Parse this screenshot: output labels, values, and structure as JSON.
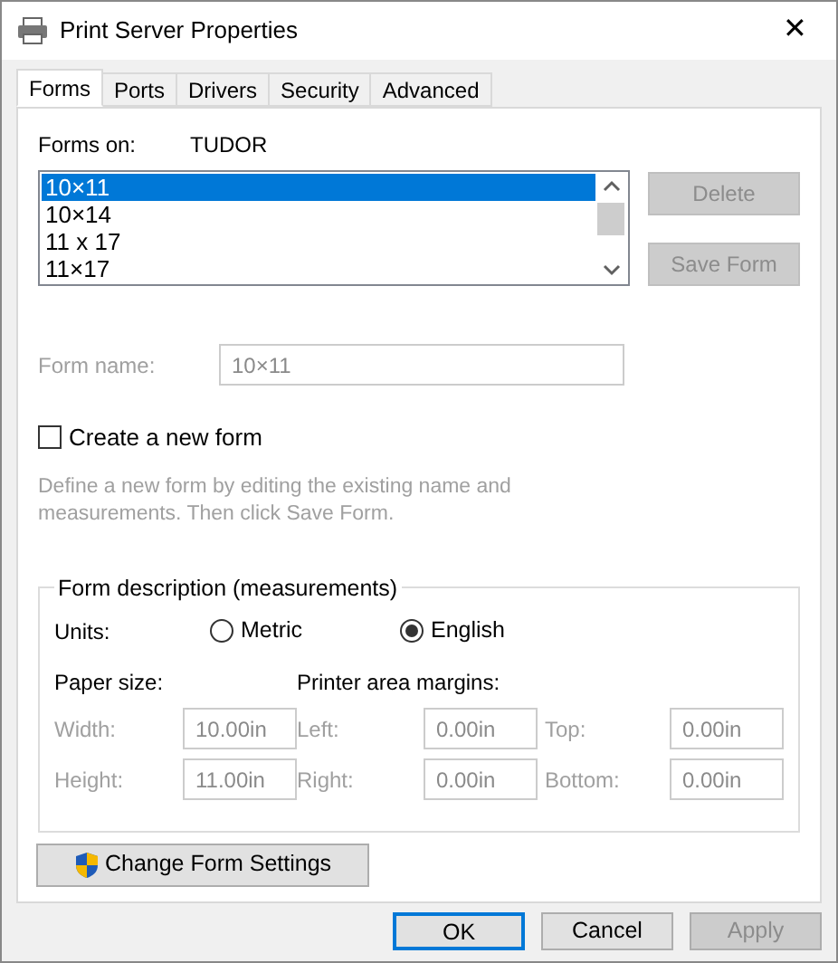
{
  "window": {
    "title": "Print Server Properties",
    "close": "✕"
  },
  "tabs": [
    {
      "label": "Forms",
      "selected": true
    },
    {
      "label": "Ports",
      "selected": false
    },
    {
      "label": "Drivers",
      "selected": false
    },
    {
      "label": "Security",
      "selected": false
    },
    {
      "label": "Advanced",
      "selected": false
    }
  ],
  "forms_on": {
    "label": "Forms on:",
    "value": "TUDOR"
  },
  "forms_list": [
    {
      "label": "10×11",
      "selected": true
    },
    {
      "label": "10×14",
      "selected": false
    },
    {
      "label": "11 x 17",
      "selected": false
    },
    {
      "label": "11×17",
      "selected": false
    }
  ],
  "list_buttons": [
    {
      "label": "Delete",
      "disabled": true
    },
    {
      "label": "Save Form",
      "disabled": true
    }
  ],
  "form_name": {
    "label": "Form name:",
    "value": "10×11",
    "disabled": true
  },
  "create_new_form": {
    "label": "Create a new form",
    "checked": false
  },
  "hint": "Define a new form by editing the existing name and measurements. Then click Save Form.",
  "form_description": {
    "title": "Form description (measurements)",
    "units": {
      "label": "Units:",
      "options": [
        {
          "label": "Metric",
          "selected": false
        },
        {
          "label": "English",
          "selected": true
        }
      ]
    },
    "paper_size": {
      "label": "Paper size:",
      "fields": [
        {
          "label": "Width:",
          "value": "10.00in",
          "disabled": true
        },
        {
          "label": "Height:",
          "value": "11.00in",
          "disabled": true
        }
      ]
    },
    "margins": {
      "label": "Printer area margins:",
      "fields": [
        {
          "label": "Left:",
          "value": "0.00in",
          "disabled": true
        },
        {
          "label": "Top:",
          "value": "0.00in",
          "disabled": true
        },
        {
          "label": "Right:",
          "value": "0.00in",
          "disabled": true
        },
        {
          "label": "Bottom:",
          "value": "0.00in",
          "disabled": true
        }
      ]
    }
  },
  "change_settings_button": {
    "label": "Change Form Settings"
  },
  "dialog_buttons": [
    {
      "label": "OK",
      "default": true,
      "disabled": false
    },
    {
      "label": "Cancel",
      "default": false,
      "disabled": false
    },
    {
      "label": "Apply",
      "default": false,
      "disabled": true
    }
  ]
}
